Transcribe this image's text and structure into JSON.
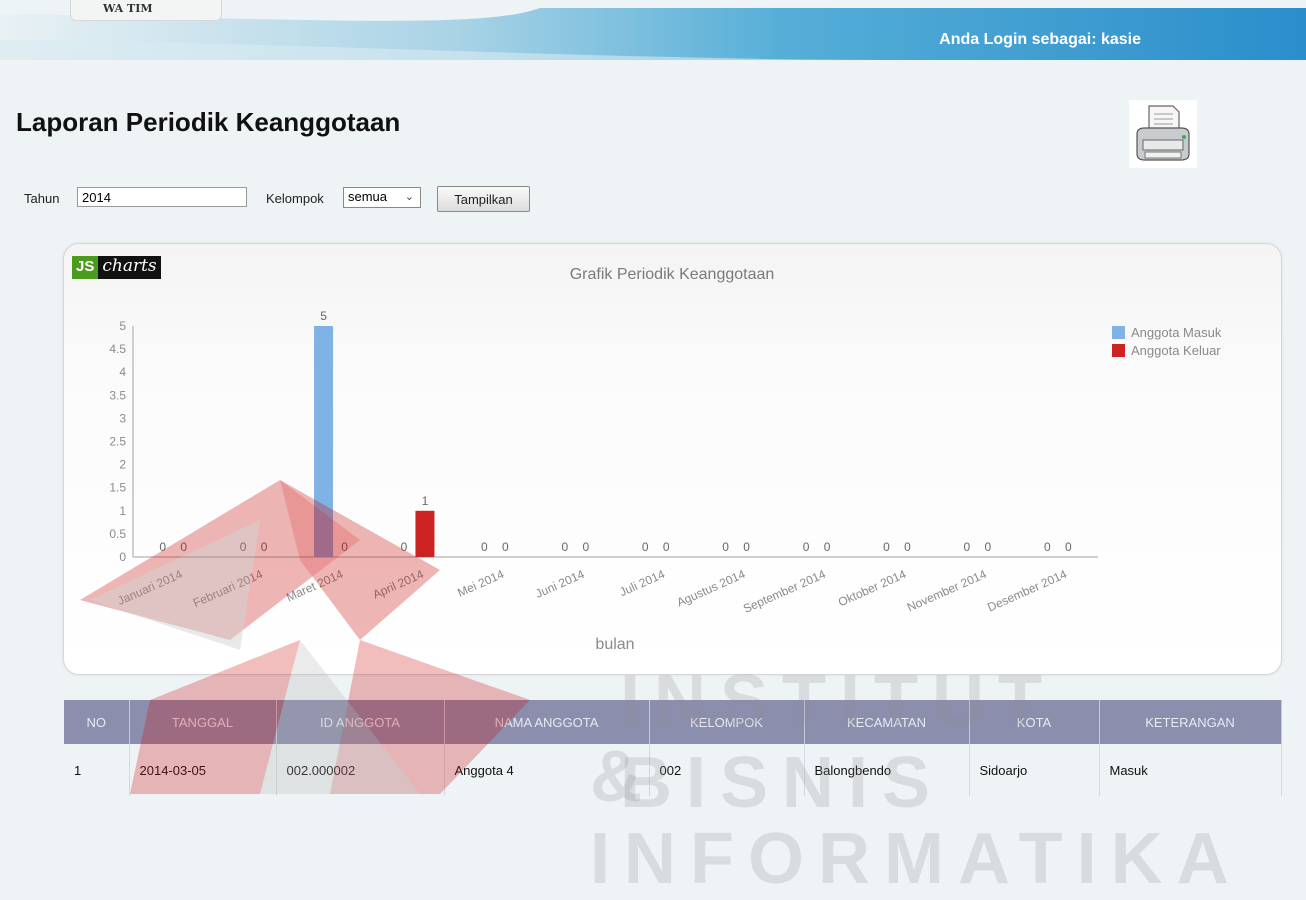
{
  "header": {
    "logo_text": "WA TIM",
    "login_text": "Anda Login sebagai: kasie"
  },
  "page_title": "Laporan Periodik Keanggotaan",
  "filters": {
    "tahun_label": "Tahun",
    "tahun_value": "2014",
    "kelompok_label": "Kelompok",
    "kelompok_value": "semua",
    "submit_label": "Tampilkan"
  },
  "chart_logo": {
    "js": "JS",
    "charts": "charts"
  },
  "chart_data": {
    "type": "bar",
    "title": "Grafik Periodik Keanggotaan",
    "xlabel": "bulan",
    "ylabel": "",
    "ylim": [
      0,
      5
    ],
    "yticks": [
      "0",
      "0.5",
      "1",
      "1.5",
      "2",
      "2.5",
      "3",
      "3.5",
      "4",
      "4.5",
      "5"
    ],
    "categories": [
      "Januari 2014",
      "Februari 2014",
      "Maret 2014",
      "April 2014",
      "Mei 2014",
      "Juni 2014",
      "Juli 2014",
      "Agustus 2014",
      "September 2014",
      "Oktober 2014",
      "November 2014",
      "Desember 2014"
    ],
    "series": [
      {
        "name": "Anggota Masuk",
        "color": "#7fb2e5",
        "values": [
          0,
          0,
          5,
          0,
          0,
          0,
          0,
          0,
          0,
          0,
          0,
          0
        ]
      },
      {
        "name": "Anggota Keluar",
        "color": "#cc2222",
        "values": [
          0,
          0,
          0,
          1,
          0,
          0,
          0,
          0,
          0,
          0,
          0,
          0
        ]
      }
    ],
    "legend_position": "top-right"
  },
  "table": {
    "headers": [
      "NO",
      "TANGGAL",
      "ID ANGGOTA",
      "NAMA ANGGOTA",
      "KELOMPOK",
      "KECAMATAN",
      "KOTA",
      "KETERANGAN"
    ],
    "rows": [
      [
        "1",
        "2014-03-05",
        "002.000002",
        "Anggota 4",
        "002",
        "Balongbendo",
        "Sidoarjo",
        "Masuk"
      ]
    ]
  },
  "watermark": {
    "line1": "INSTITUT BISNIS",
    "line2": "& INFORMATIKA"
  },
  "icons": {
    "printer": "printer-icon"
  }
}
